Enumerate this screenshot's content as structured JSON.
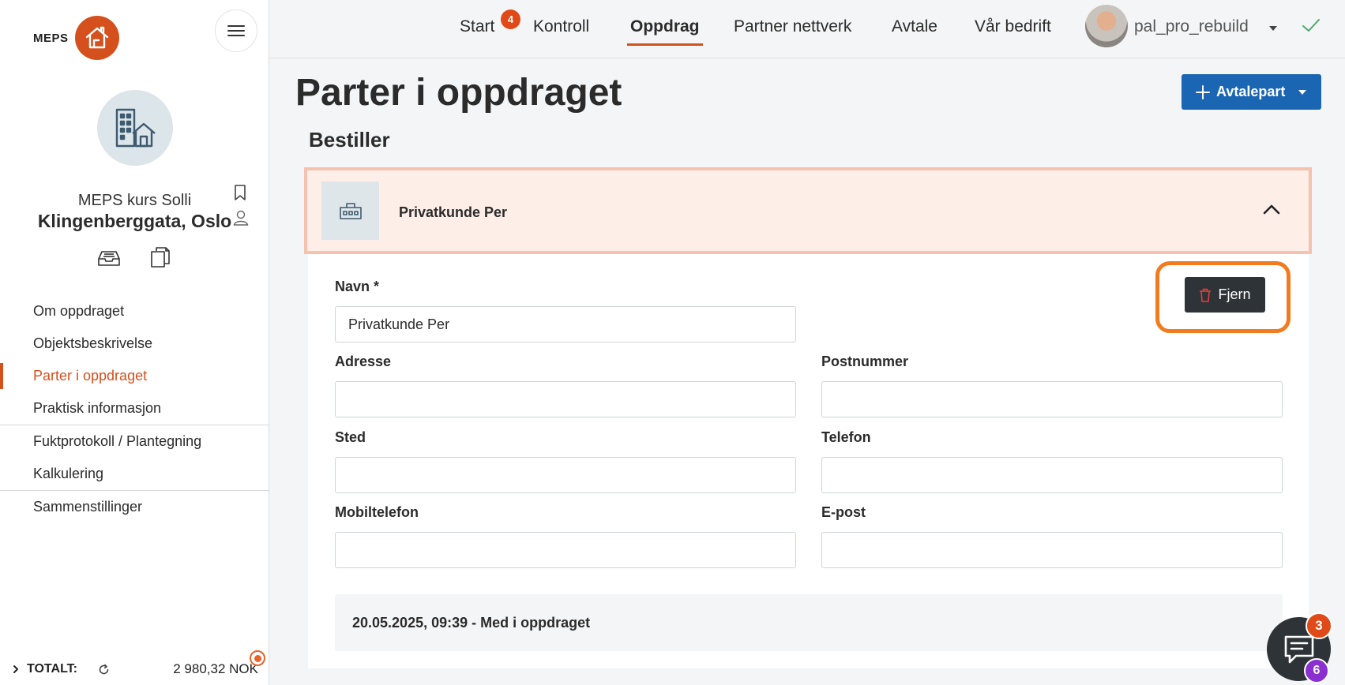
{
  "brand": {
    "logo_text": "MEPS",
    "accent": "#d4501c",
    "primary": "#1a66b3"
  },
  "project": {
    "name": "MEPS kurs Solli",
    "address": "Klingenberggata, Oslo"
  },
  "sidebar": {
    "groups": [
      [
        "Om oppdraget",
        "Objektsbeskrivelse",
        "Parter i oppdraget",
        "Praktisk informasjon"
      ],
      [
        "Fuktprotokoll / Plantegning",
        "Kalkulering"
      ],
      [
        "Sammenstillinger"
      ]
    ],
    "active": "Parter i oppdraget",
    "footer": {
      "total_label": "TOTALT:",
      "total_value": "2 980,32 NOK"
    }
  },
  "topnav": {
    "items": [
      "Start",
      "Kontroll",
      "Oppdrag",
      "Partner nettverk",
      "Avtale",
      "Vår bedrift"
    ],
    "active": "Oppdrag",
    "start_badge": "4",
    "username": "pal_pro_rebuild"
  },
  "page": {
    "title": "Parter i oppdraget",
    "add_button": "Avtalepart",
    "section": "Bestiller"
  },
  "card": {
    "title": "Privatkunde Per",
    "remove_button": "Fjern",
    "fields": {
      "navn": {
        "label": "Navn *",
        "value": "Privatkunde Per"
      },
      "adresse": {
        "label": "Adresse",
        "value": ""
      },
      "postnummer": {
        "label": "Postnummer",
        "value": ""
      },
      "sted": {
        "label": "Sted",
        "value": ""
      },
      "telefon": {
        "label": "Telefon",
        "value": ""
      },
      "mobiltelefon": {
        "label": "Mobiltelefon",
        "value": ""
      },
      "epost": {
        "label": "E-post",
        "value": ""
      }
    },
    "history": "20.05.2025, 09:39 - Med i oppdraget"
  },
  "chat": {
    "badge_top": "3",
    "badge_bottom": "6"
  }
}
